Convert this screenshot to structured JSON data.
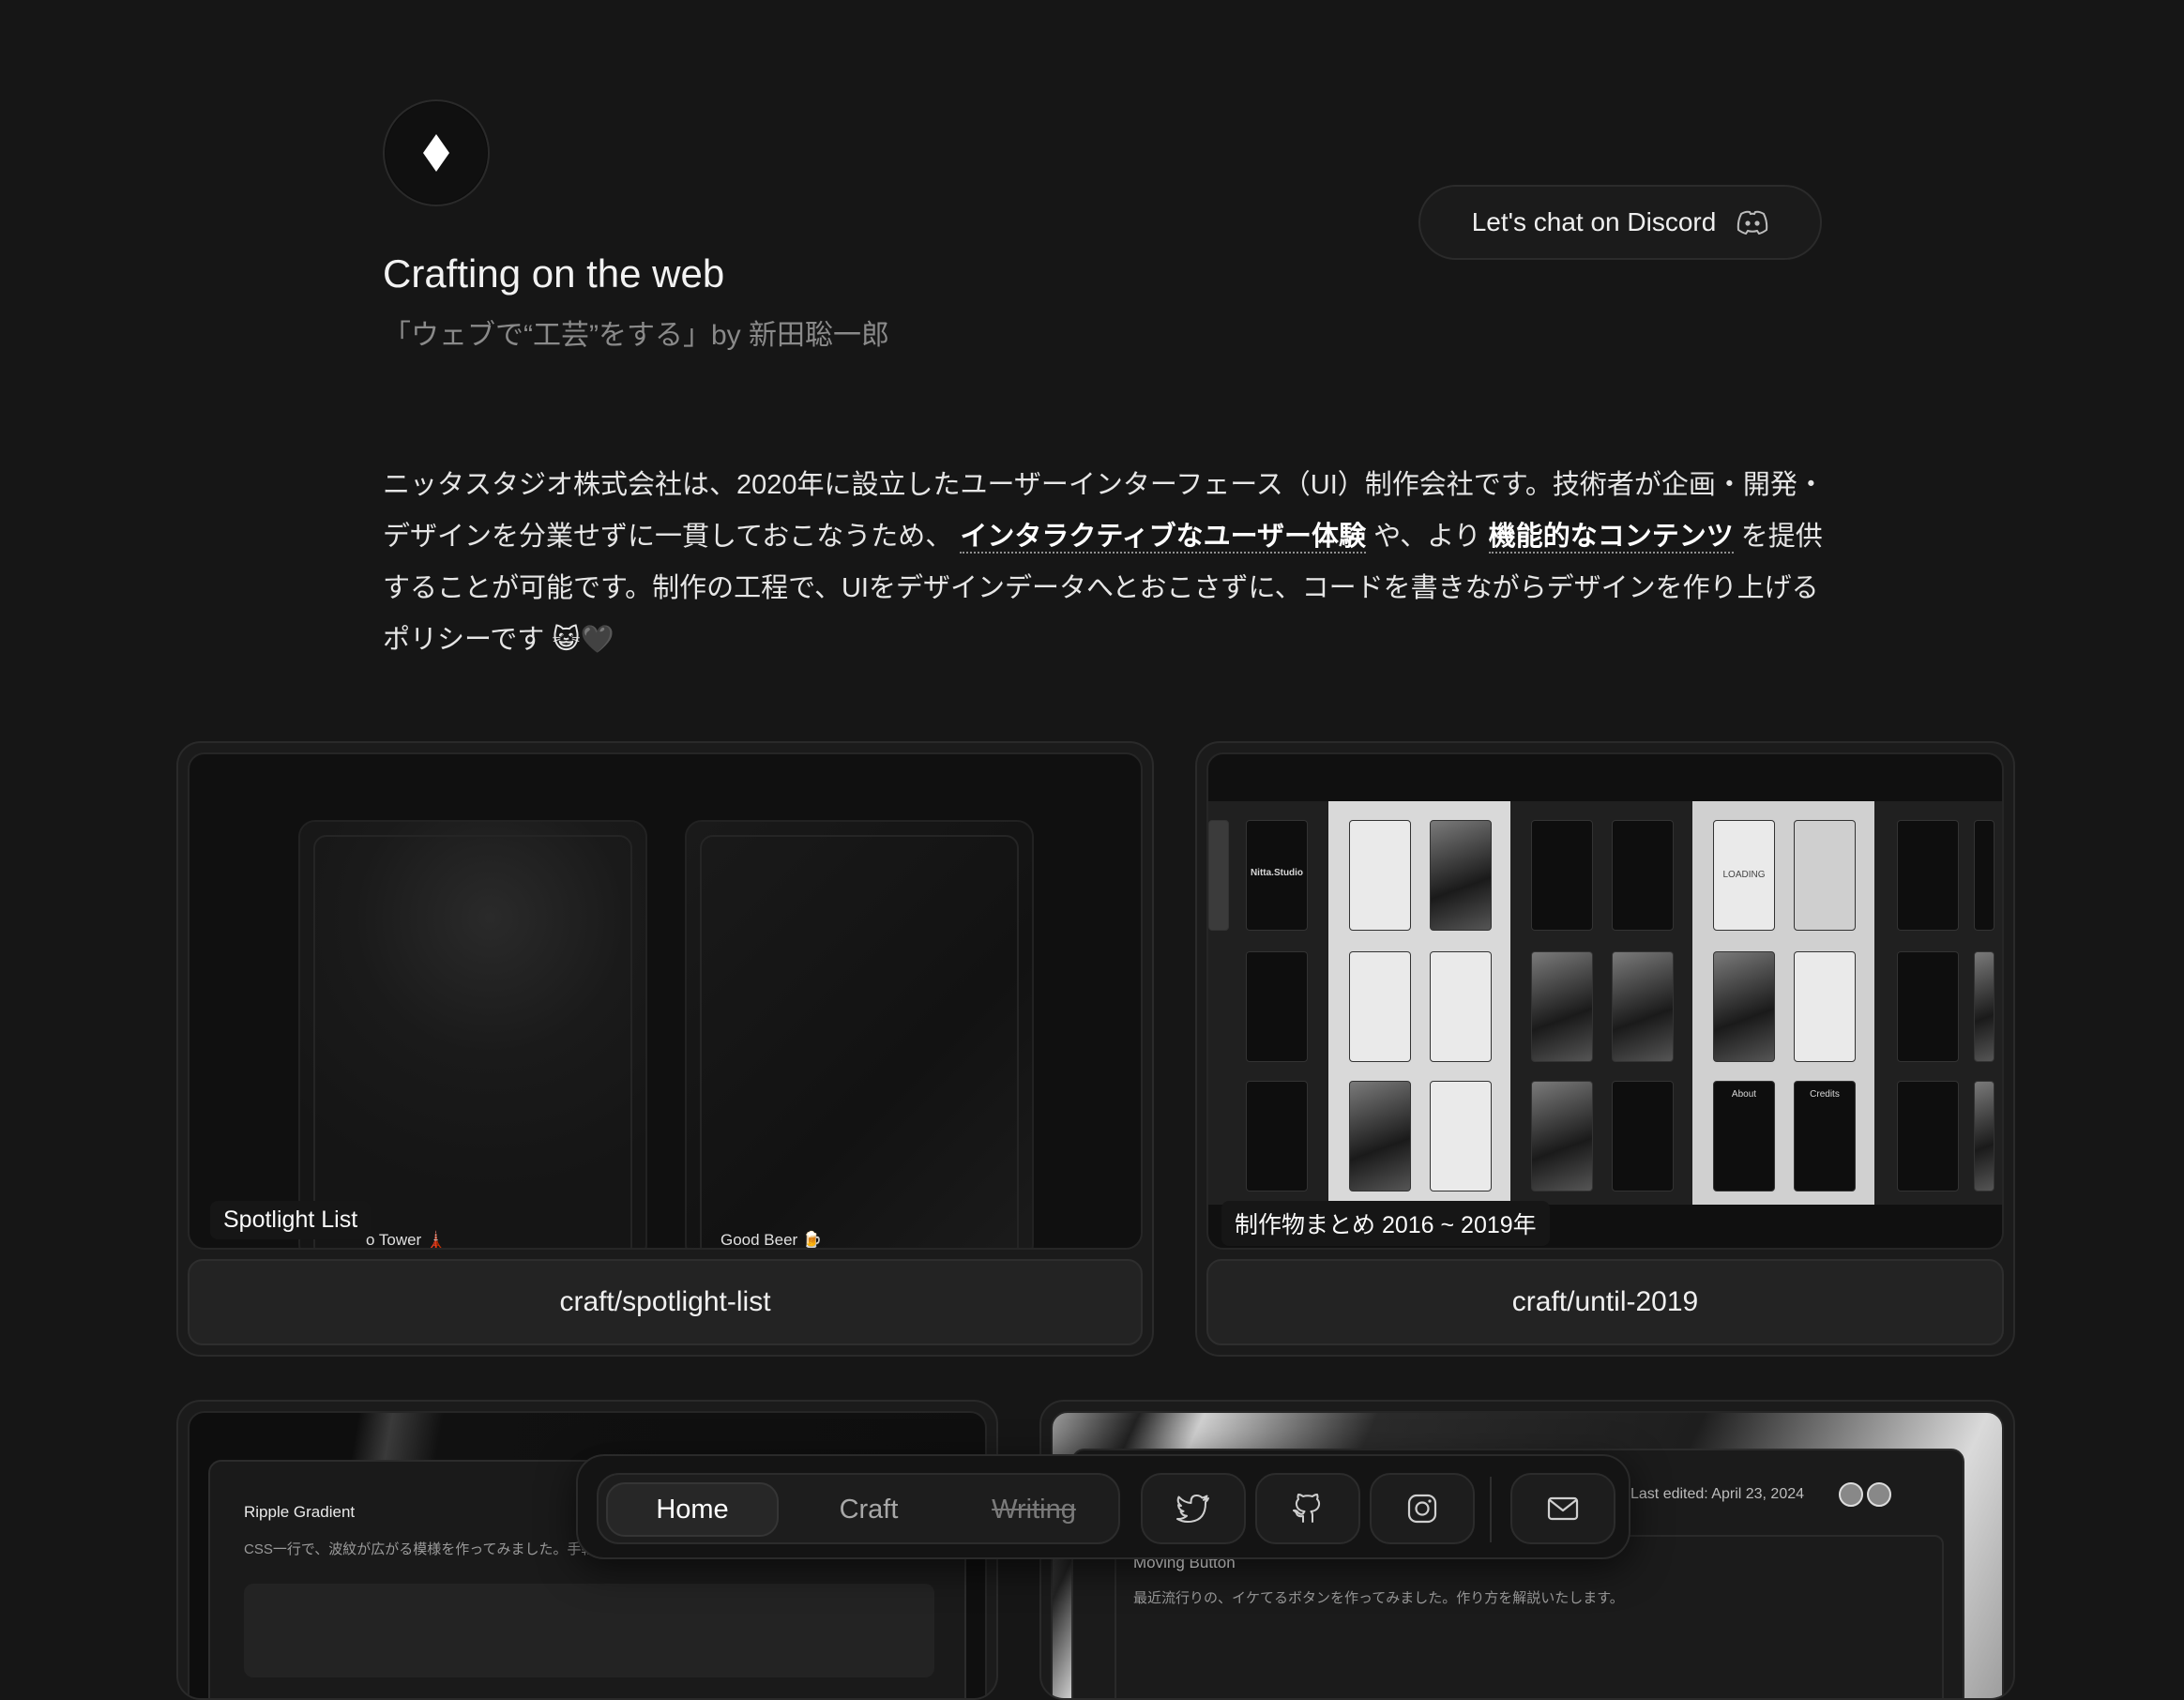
{
  "header": {
    "title": "Crafting on the web",
    "subtitle": "「ウェブで“工芸”をする」by 新田聡一郎",
    "logo_icon": "diamond-icon",
    "discord_button": {
      "label": "Let's chat on Discord",
      "icon": "discord-icon"
    }
  },
  "intro": {
    "part1": "ニッタスタジオ株式会社は、2020年に設立したユーザーインターフェース（UI）制作会社です。技術者が企画・開発・デザインを分業せずに一貫しておこなうため、",
    "link1": "インタラクティブなユーザー体験",
    "part2": "や、より",
    "link2": "機能的なコンテンツ",
    "part3": "を提供することが可能です。制作の工程で、UIをデザインデータへとおこさずに、コードを書きながらデザインを作り上げるポリシーです",
    "emoji": "😺🖤"
  },
  "cards": [
    {
      "preview_badge": "Spotlight List",
      "mini_captions": [
        "o Tower 🗼",
        "Good Beer 🍺"
      ],
      "label": "craft/spotlight-list"
    },
    {
      "preview_badge": "制作物まとめ 2016 ~ 2019年",
      "tiles_text": [
        "Nitta.Studio",
        "LOADING",
        "About",
        "Credits"
      ],
      "label": "craft/until-2019"
    }
  ],
  "bottom_cards": [
    {
      "title": "Ripple Gradient",
      "desc": "CSS一行で、波紋が広がる模様を作ってみました。手軽に実装できるシンプルなギミックです。"
    },
    {
      "title": "Moving Button",
      "desc": "最近流行りの、イケてるボタンを作ってみました。作り方を解説いたします。",
      "last_edited": "Last edited: April 23, 2024"
    }
  ],
  "dock": {
    "nav": [
      {
        "label": "Home",
        "active": true
      },
      {
        "label": "Craft",
        "active": false
      },
      {
        "label": "Writing",
        "active": false,
        "disabled": true
      }
    ],
    "icons": [
      "twitter-icon",
      "github-icon",
      "instagram-icon",
      "mail-icon"
    ]
  },
  "colors": {
    "background": "#161616",
    "card": "#1b1b1b",
    "text": "#ededed",
    "muted": "#8a8a8a"
  }
}
